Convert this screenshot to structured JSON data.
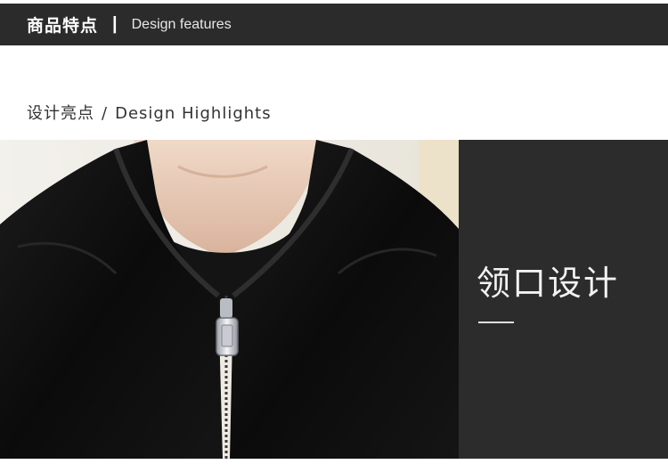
{
  "header": {
    "title_cn": "商品特点",
    "separator": "|",
    "title_en": "Design features"
  },
  "section": {
    "title_cn": "设计亮点",
    "separator": "/",
    "title_en": "Design Highlights"
  },
  "feature": {
    "heading": "领口设计"
  },
  "colors": {
    "header_bg": "#2b2b2b",
    "panel_bg": "#2c2c2c",
    "text_dark": "#333333",
    "text_light": "#f2f2f2"
  }
}
